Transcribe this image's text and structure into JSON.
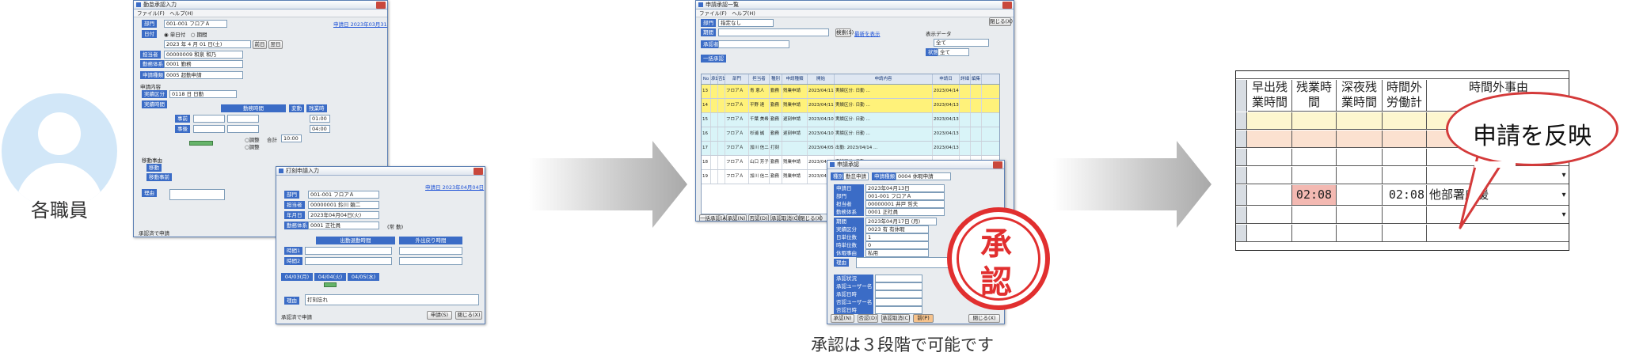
{
  "user": {
    "label": "各職員",
    "colors": {
      "circle": "#d2e7f8"
    }
  },
  "window1": {
    "title": "勤怠承認入力",
    "menu": "ファイル(F)　ヘルプ(H)",
    "dept_label": "部門",
    "dept_value": "001-001 フロアＡ",
    "apply_link": "申請日 2023年03月31日",
    "date_label": "日付",
    "radio_text": "◉ 単日付　○ 期間",
    "date_value": "2023 年 4 月 01 日(土)",
    "prev_btn": "前日",
    "next_btn": "翌日",
    "staff_label": "担当者",
    "staff_value": "00000009 和泉 和乃",
    "type_label": "勤務体系",
    "type_value": "0001 勤務",
    "kind_label": "申請種類",
    "kind_value": "0005 超勤申請",
    "content_label": "申請内容",
    "shift_label": "実績区分",
    "shift_value": "0118 日 日勤",
    "actual_label": "実績時間",
    "work_time_label": "勤務時間",
    "change_label": "変動",
    "overtime_label": "残業時",
    "before_btn": "事前",
    "after_btn": "事後",
    "status1": "○調整",
    "status2": "○調整",
    "total_label": "合計",
    "total_value": "10:00",
    "time_a": "01:00",
    "time_b": "04:00",
    "move_label": "移動事由",
    "move_a": "移動",
    "move_b": "移動事前",
    "reason_label": "理由",
    "flag": "承認済で申請"
  },
  "window2": {
    "title": "打刻申請入力",
    "apply_link": "申請日 2023年04月04日",
    "dept_label": "部門",
    "dept_value": "001-001 フロアＡ",
    "staff_label": "担当者",
    "staff_value": "00000001 鈴川 頼二",
    "date_label": "年月日",
    "date_value": "2023年04月04日(火)",
    "type_label": "勤務体系",
    "type_value": "0001 正社員",
    "type_extra": "(常 勤)",
    "attend_label": "出勤退勤時間",
    "out_label": "外出戻り時間",
    "period1": "時間1",
    "period2": "時間2",
    "days": [
      "04/03(月)",
      "04/04(火)",
      "04/05(水)"
    ],
    "reason_label": "理由",
    "reason_value": "打刻忘れ",
    "flag": "承認済で申請",
    "submit_btn": "申請(S)",
    "close_btn": "閉じる(X)"
  },
  "window3": {
    "title": "申請承認一覧",
    "menu": "ファイル(F)　ヘルプ(H)",
    "dept_label": "部門",
    "dept_value": "指定なし",
    "period_label": "期間",
    "approver_label": "承認者",
    "search_btn": "検索(S)",
    "close_btn": "閉じる(X)",
    "flow_link": "最新を表示",
    "show_label": "表示データ",
    "show_value": "全て",
    "status_label": "状態",
    "status_value": "全て",
    "bulk_label": "一括承認",
    "headers": [
      "No",
      "承認",
      "否認",
      "部門",
      "担当者",
      "種別",
      "申請種類",
      "開始",
      "申請内容",
      "申請日",
      "詳細",
      "編集"
    ],
    "rows": [
      {
        "no": "13",
        "dept": "フロアＡ",
        "staff": "青 恵人",
        "kind": "勤務",
        "apply": "残業申請",
        "date": "2023/04/11",
        "content": "実績区分: 日勤 …",
        "applied": "2023/04/14"
      },
      {
        "no": "14",
        "dept": "フロアＡ",
        "staff": "平野 達",
        "kind": "勤務",
        "apply": "残業申請",
        "date": "2023/04/11",
        "content": "実績区分: 日勤 …",
        "applied": "2023/04/13"
      },
      {
        "no": "15",
        "dept": "フロアＡ",
        "staff": "千葉 美希",
        "kind": "勤務",
        "apply": "遅刻申請",
        "date": "2023/04/10",
        "content": "実績区分: 日勤 …",
        "applied": "2023/04/13"
      },
      {
        "no": "16",
        "dept": "フロアＡ",
        "staff": "杉浦 誠",
        "kind": "勤務",
        "apply": "遅刻申請",
        "date": "2023/04/10",
        "content": "実績区分: 日勤 …",
        "applied": "2023/04/13"
      },
      {
        "no": "17",
        "dept": "フロアＡ",
        "staff": "加川 信二",
        "kind": "打刻",
        "apply": "",
        "date": "2023/04/05",
        "content": "出勤: 2023/04/14 …",
        "applied": "2023/04/13"
      },
      {
        "no": "18",
        "dept": "フロアＡ",
        "staff": "山口 芳子",
        "kind": "勤務",
        "apply": "残業申請",
        "date": "2023/04/11",
        "content": "実績区分: 日勤 …",
        "applied": "2023/04/13"
      },
      {
        "no": "19",
        "dept": "フロアＡ",
        "staff": "加川 信二",
        "kind": "勤務",
        "apply": "残業申請",
        "date": "2023/04/10",
        "content": "実績区分: 日勤 …",
        "applied": "2023/04/13"
      }
    ],
    "bottom_buttons": [
      "一括承認(A)",
      "承認(N)",
      "否認(D)",
      "承認取消(C)",
      "閉じる(X)"
    ]
  },
  "window4": {
    "title": "申請承認",
    "section_label": "種別",
    "section_value": "勤怠申請",
    "kind_label": "申請種類",
    "kind_value": "0004 休暇申請",
    "rows": [
      {
        "label": "申請日",
        "value": "2023年04月13日"
      },
      {
        "label": "部門",
        "value": "001-001 フロアＡ"
      },
      {
        "label": "担当者",
        "value": "00000001 井戸 哲夫"
      },
      {
        "label": "勤務体系",
        "value": "0001 正社員"
      }
    ],
    "detail_rows": [
      {
        "label": "期間",
        "value": "2023年04月17日 (月)"
      },
      {
        "label": "実績区分",
        "value": "0023 有 有休暇"
      },
      {
        "label": "日単位数",
        "value": "1"
      },
      {
        "label": "時単位数",
        "value": "0"
      },
      {
        "label": "休暇事由",
        "value": "私用"
      }
    ],
    "reason_label": "理由",
    "approve_rows": [
      "承認状況",
      "承認ユーザー名",
      "承認日時",
      "否認ユーザー名",
      "否認日時"
    ],
    "buttons": [
      "承認(N)",
      "否認(D)",
      "承認取消(C)",
      "前(P)",
      "閉じる(X)"
    ]
  },
  "stamp": {
    "char1": "承",
    "char2": "認",
    "color": "#e12f2f"
  },
  "caption": "承認は３段階で可能です",
  "grid": {
    "headers": [
      "早出残業時間",
      "残業時間",
      "深夜残業時間",
      "時間外労働計",
      "時間外事由"
    ],
    "overtime": "02:08",
    "total": "02:08",
    "reason": "他部署応援",
    "dropdown": "▾",
    "colors": {
      "yellow": "#fdf6cf",
      "peach": "#fbe1d0",
      "pink": "#f3b9b2"
    }
  },
  "bubble": {
    "text": "申請を反映",
    "border": "#d43a3a"
  }
}
